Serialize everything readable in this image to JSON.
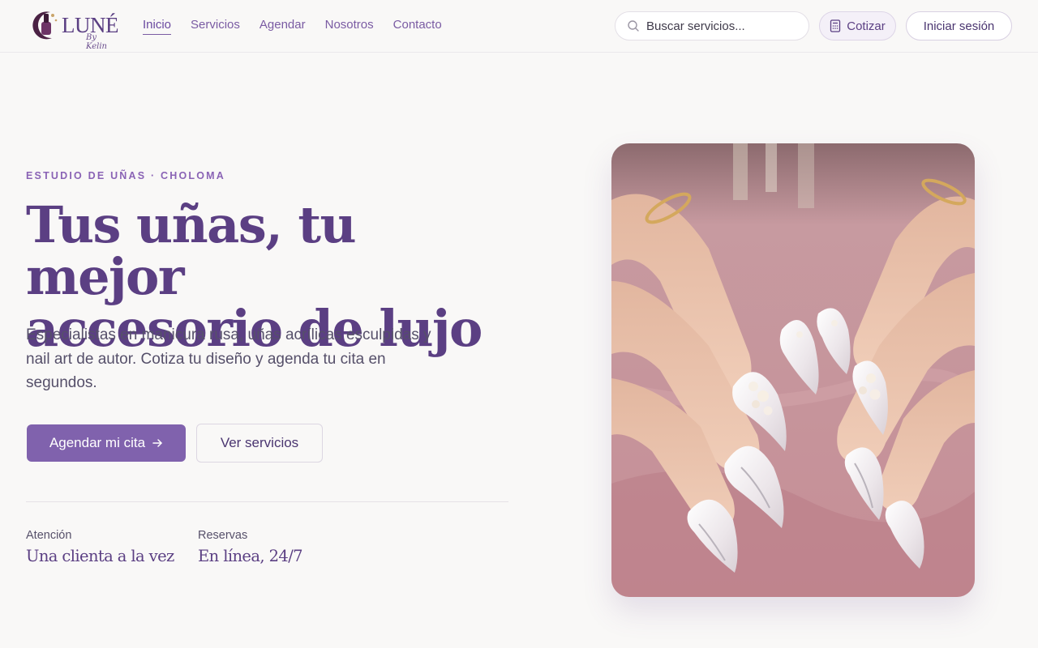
{
  "header": {
    "logo": {
      "text": "LUNÉ",
      "sub": "By Kelin",
      "icon": "nail-polish-moon-logo"
    },
    "nav": [
      "Inicio",
      "Servicios",
      "Agendar",
      "Nosotros",
      "Contacto"
    ],
    "active_nav": "Inicio",
    "search": {
      "placeholder": "Buscar servicios...",
      "icon": "search-icon"
    },
    "quote_button": {
      "label": "Cotizar",
      "icon": "calculator-icon"
    },
    "login_button": "Iniciar sesión"
  },
  "hero": {
    "eyebrow": "ESTUDIO DE UÑAS · CHOLOMA",
    "title_line1": "Tus uñas, tu mejor",
    "title_line2": "accesorio de lujo",
    "description": "Especialistas en manicura rusa, uñas acrílicas esculpidas y nail art de autor. Cotiza tu diseño y agenda tu cita en segundos.",
    "primary_cta": "Agendar mi cita",
    "primary_cta_icon": "arrow-right-icon",
    "secondary_cta": "Ver servicios",
    "stats": [
      {
        "label": "Atención",
        "value": "Una clienta a la vez"
      },
      {
        "label": "Reservas",
        "value": "En línea, 24/7"
      }
    ],
    "image": "manicured-hands-pearl-nail-art-photo"
  },
  "colors": {
    "brand": "#5b3f83",
    "accent": "#8062ad",
    "background": "#f9f8f7"
  }
}
